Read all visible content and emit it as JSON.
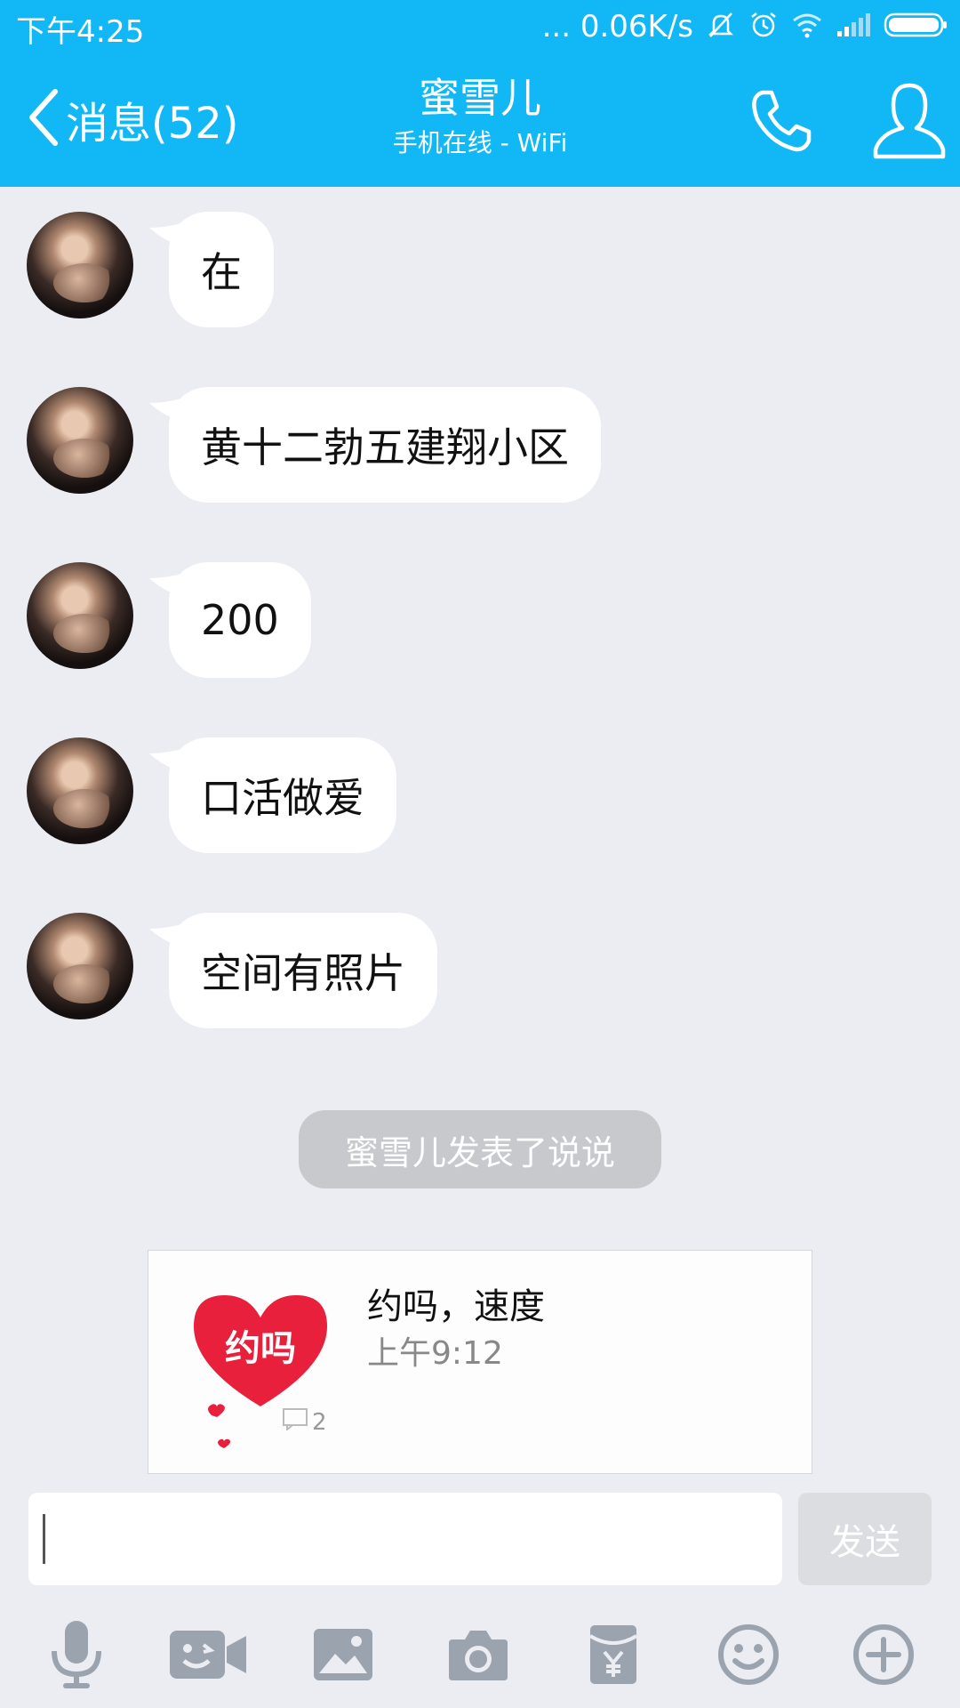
{
  "status_bar": {
    "time": "下午4:25",
    "network_speed": "... 0.06K/s"
  },
  "header": {
    "back_label": "消息(52)",
    "contact_name": "蜜雪儿",
    "contact_status": "手机在线 - WiFi",
    "accent_color": "#12b7f5"
  },
  "messages": [
    {
      "text": "在"
    },
    {
      "text": "黄十二勃五建翔小区"
    },
    {
      "text": "200"
    },
    {
      "text": "口活做爱"
    },
    {
      "text": "空间有照片"
    }
  ],
  "system_notice": "蜜雪儿发表了说说",
  "post_card": {
    "title": "约吗，速度",
    "time": "上午9:12",
    "thumb_text": "约吗",
    "comment_count": "2"
  },
  "composer": {
    "input_value": "",
    "send_label": "发送"
  },
  "toolbar_icons": [
    "microphone-icon",
    "video-icon",
    "image-icon",
    "camera-icon",
    "red-packet-icon",
    "emoji-icon",
    "plus-icon"
  ]
}
